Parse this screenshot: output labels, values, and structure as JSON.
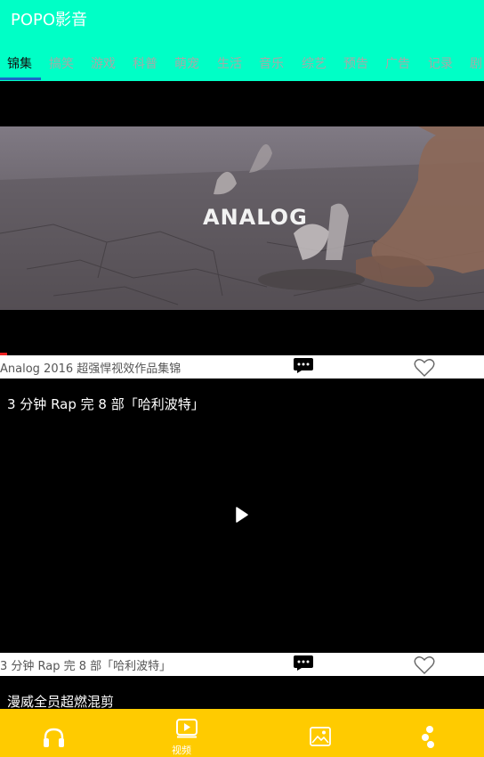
{
  "app": {
    "title": "POPO影音"
  },
  "tabs": [
    "锦集",
    "搞笑",
    "游戏",
    "科普",
    "萌宠",
    "生活",
    "音乐",
    "综艺",
    "预告",
    "广告",
    "记录",
    "剧"
  ],
  "active_tab": 0,
  "videos": [
    {
      "overlay_title": "ANALOG",
      "bar_title": "Analog 2016 超强悍视效作品集锦"
    },
    {
      "title": "3 分钟 Rap 完 8 部「哈利波特」",
      "bar_title": "3 分钟 Rap 完 8 部「哈利波特」"
    },
    {
      "title": "漫威全员超燃混剪"
    }
  ],
  "bottom_nav": [
    {
      "icon": "headphones-icon",
      "label": ""
    },
    {
      "icon": "video-play-icon",
      "label": "视频"
    },
    {
      "icon": "image-icon",
      "label": ""
    },
    {
      "icon": "more-dots-icon",
      "label": ""
    }
  ],
  "colors": {
    "header": "#00FFC6",
    "bottom_nav": "#FFCB00",
    "tab_indicator": "#1a66c9"
  }
}
